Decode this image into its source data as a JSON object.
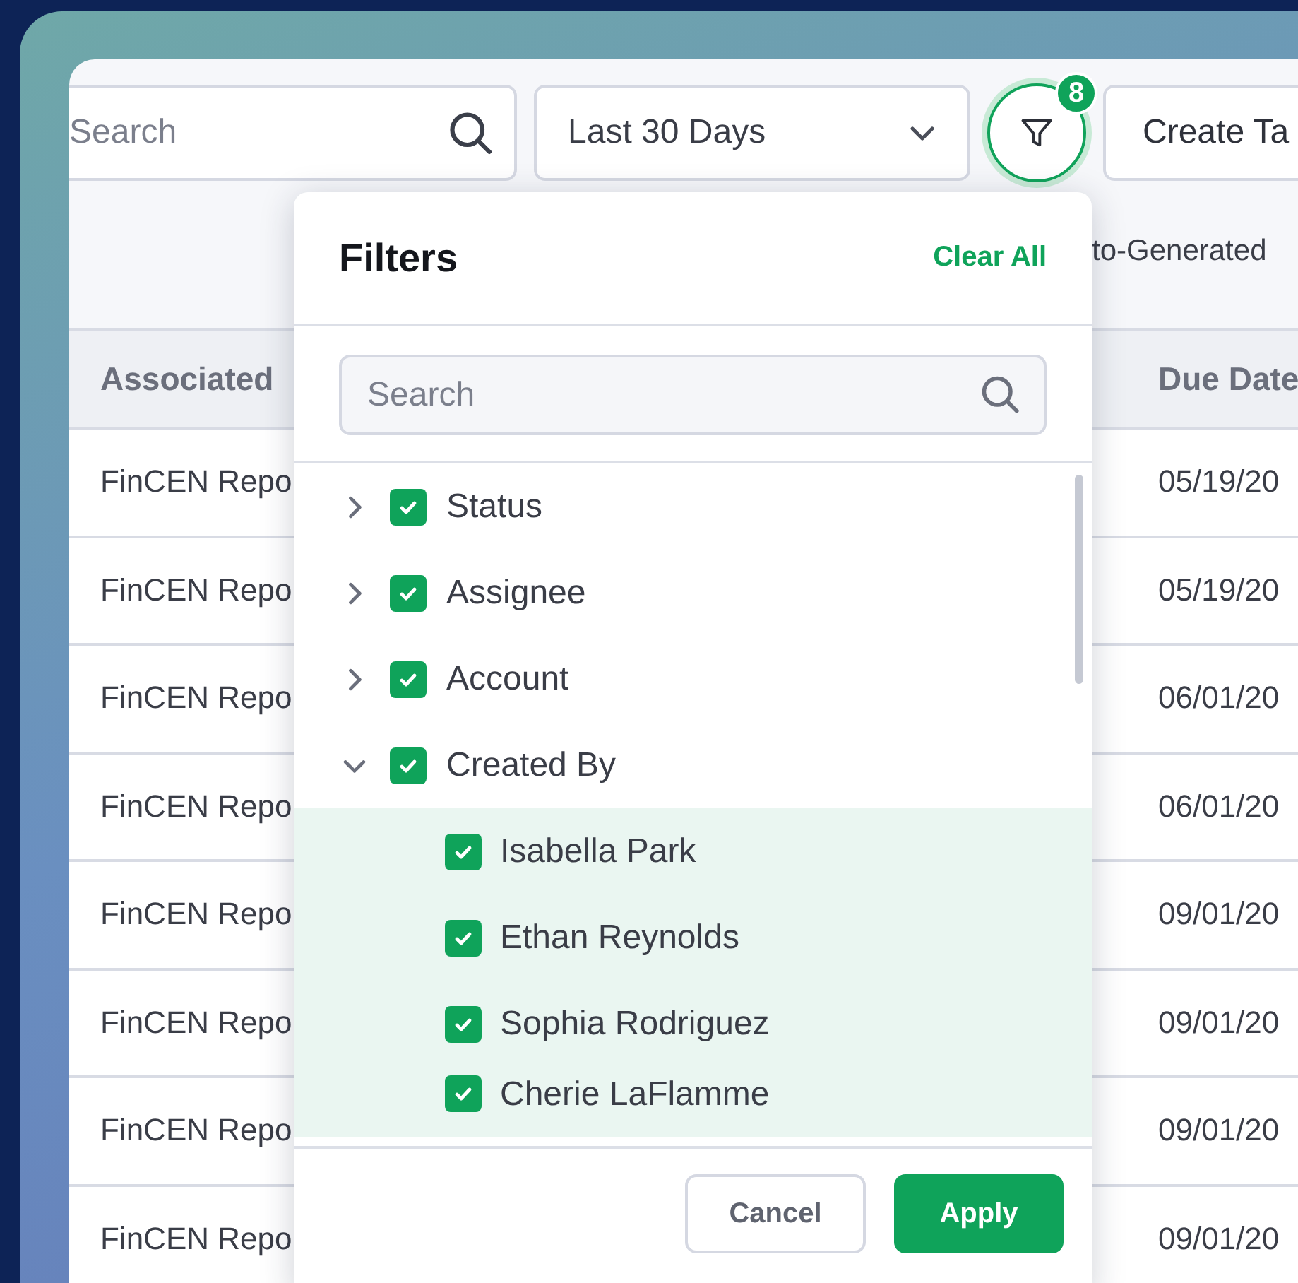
{
  "toolbar": {
    "search": {
      "placeholder": "Search"
    },
    "date_range": {
      "value": "Last 30 Days"
    },
    "filter_button": {
      "badge": "8"
    },
    "create_button": {
      "label": "Create Ta"
    }
  },
  "subheader": {
    "text": "to-Generated"
  },
  "table": {
    "columns": [
      "Associated",
      "Due Date"
    ],
    "rows": [
      [
        "FinCEN Repo",
        "05/19/20"
      ],
      [
        "FinCEN Repo",
        "05/19/20"
      ],
      [
        "FinCEN Repo",
        "06/01/20"
      ],
      [
        "FinCEN Repo",
        "06/01/20"
      ],
      [
        "FinCEN Repo",
        "09/01/20"
      ],
      [
        "FinCEN Repo",
        "09/01/20"
      ],
      [
        "FinCEN Repo",
        "09/01/20"
      ],
      [
        "FinCEN Repo",
        "09/01/20"
      ]
    ]
  },
  "filters": {
    "title": "Filters",
    "clear_all": "Clear All",
    "search": {
      "placeholder": "Search"
    },
    "items": [
      {
        "label": "Status",
        "checked": true,
        "expanded": false
      },
      {
        "label": "Assignee",
        "checked": true,
        "expanded": false
      },
      {
        "label": "Account",
        "checked": true,
        "expanded": false
      },
      {
        "label": "Created By",
        "checked": true,
        "expanded": true,
        "children": [
          {
            "label": "Isabella Park",
            "checked": true
          },
          {
            "label": "Ethan Reynolds",
            "checked": true
          },
          {
            "label": "Sophia Rodriguez",
            "checked": true
          },
          {
            "label": "Cherie LaFlamme",
            "checked": true
          }
        ]
      }
    ],
    "buttons": [
      {
        "label": "Cancel",
        "kind": "secondary"
      },
      {
        "label": "Apply",
        "kind": "primary"
      }
    ]
  }
}
